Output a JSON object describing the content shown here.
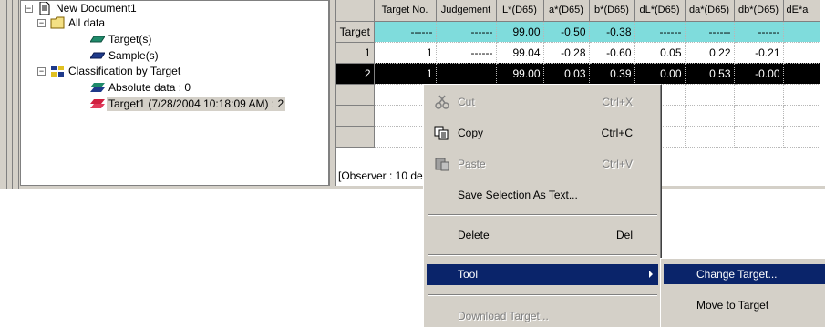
{
  "tree": {
    "root": "New Document1",
    "all_data": "All data",
    "target": "Target(s)",
    "sample": "Sample(s)",
    "classification": "Classification by Target",
    "absolute": "Absolute data : 0",
    "target1": "Target1 (7/28/2004 10:18:09 AM) : 2",
    "expand_minus": "−"
  },
  "grid": {
    "columns": [
      "Target No.",
      "Judgement",
      "L*(D65)",
      "a*(D65)",
      "b*(D65)",
      "dL*(D65)",
      "da*(D65)",
      "db*(D65)",
      "dE*a"
    ],
    "rows": [
      {
        "label": "Target",
        "cells": [
          "------",
          "------",
          "99.00",
          "-0.50",
          "-0.38",
          "------",
          "------",
          "------",
          ""
        ]
      },
      {
        "label": "1",
        "cells": [
          "1",
          "------",
          "99.04",
          "-0.28",
          "-0.60",
          "0.05",
          "0.22",
          "-0.21",
          ""
        ]
      },
      {
        "label": "2",
        "cells": [
          "1",
          "",
          "99.00",
          "0.03",
          "0.39",
          "0.00",
          "0.53",
          "-0.00",
          ""
        ]
      },
      {
        "label": "",
        "cells": [
          "",
          "",
          "",
          "",
          "",
          "",
          "",
          "",
          ""
        ]
      },
      {
        "label": "",
        "cells": [
          "",
          "",
          "",
          "",
          "",
          "",
          "",
          "",
          ""
        ]
      },
      {
        "label": "",
        "cells": [
          "",
          "",
          "",
          "",
          "",
          "",
          "",
          "",
          ""
        ]
      }
    ]
  },
  "status": {
    "observer": "[Observer : 10 de"
  },
  "context_menu": {
    "cut": {
      "label": "Cut",
      "shortcut": "Ctrl+X"
    },
    "copy": {
      "label": "Copy",
      "shortcut": "Ctrl+C"
    },
    "paste": {
      "label": "Paste",
      "shortcut": "Ctrl+V"
    },
    "save_selection": {
      "label": "Save Selection As Text..."
    },
    "delete": {
      "label": "Delete",
      "shortcut": "Del"
    },
    "tool": {
      "label": "Tool"
    },
    "download_target": {
      "label": "Download Target..."
    }
  },
  "submenu": {
    "change_target": "Change Target...",
    "move_to_target": "Move to Target"
  },
  "colors": {
    "highlight": "#0a246a",
    "target_row": "#7fdcdc",
    "chrome": "#d4d0c8"
  }
}
